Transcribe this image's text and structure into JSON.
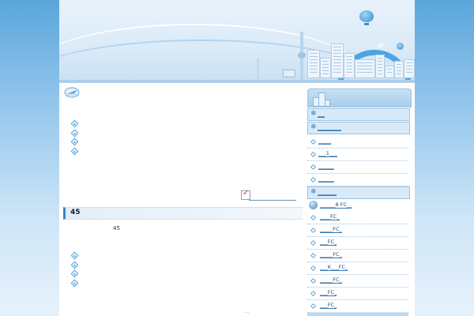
{
  "colors": {
    "page_background": "#8fc3ea",
    "accent": "#3c86c8",
    "sidebar_category": "#d8eaf8"
  },
  "main": {
    "news_items": [
      "",
      "",
      "",
      ""
    ],
    "more_label": "",
    "section": {
      "title": "45",
      "count": "45",
      "items": [
        "",
        "",
        "",
        ""
      ]
    },
    "footer_dots": "..."
  },
  "sidebar": {
    "categories": [
      {
        "label": "___"
      },
      {
        "label": "__________"
      }
    ],
    "items": [
      {
        "label": "_____"
      },
      {
        "label": "___1___"
      },
      {
        "label": "______"
      },
      {
        "label": "______"
      }
    ],
    "category3": {
      "label": "________"
    },
    "fc_header": {
      "label": "______8 FC__"
    },
    "fc_items": [
      {
        "label": "____FC_"
      },
      {
        "label": "_____FC_"
      },
      {
        "label": "___FC_"
      },
      {
        "label": "_____FC_"
      },
      {
        "label": "___K___FC_"
      },
      {
        "label": "_____FC_"
      },
      {
        "label": "___FC_"
      },
      {
        "label": "___FC_"
      }
    ]
  }
}
